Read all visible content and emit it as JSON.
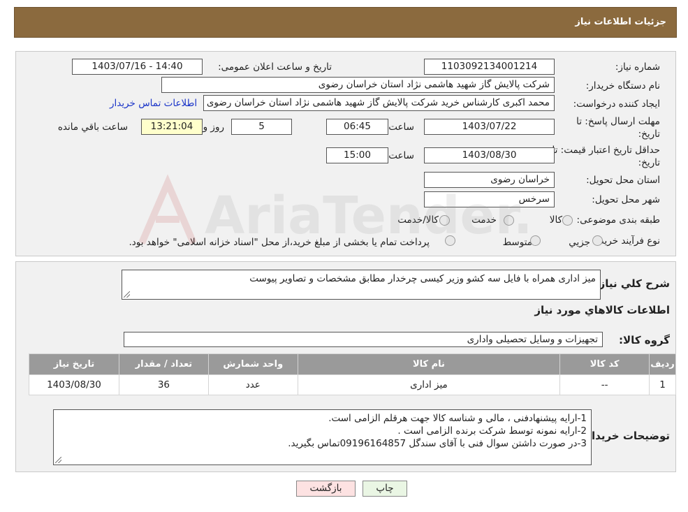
{
  "header": {
    "title": "جزئیات اطلاعات نیاز"
  },
  "form": {
    "need_number_label": "شماره نیاز:",
    "need_number": "1103092134001214",
    "announce_label": "تاریخ و ساعت اعلان عمومی:",
    "announce_value": "1403/07/16 - 14:40",
    "buyer_org_label": "نام دستگاه خریدار:",
    "buyer_org": "شرکت پالایش گاز شهید هاشمی نژاد   استان خراسان رضوی",
    "creator_label": "ایجاد کننده درخواست:",
    "creator": "محمد اکبری کارشناس خرید شرکت پالایش گاز شهید هاشمی نژاد   استان خراسان رضوی",
    "contact_link": "اطلاعات تماس خریدار",
    "deadline_label": "مهلت ارسال پاسخ: تا تاریخ:",
    "deadline_date": "1403/07/22",
    "time_label": "ساعت",
    "deadline_time": "06:45",
    "days_value": "5",
    "days_label": "روز و",
    "remaining_time": "13:21:04",
    "remaining_label": "ساعت باقي مانده",
    "validity_label": "حداقل تاریخ اعتبار قیمت: تا تاریخ:",
    "validity_date": "1403/08/30",
    "validity_time": "15:00",
    "province_label": "استان محل تحویل:",
    "province": "خراسان رضوی",
    "city_label": "شهر محل تحویل:",
    "city": "سرخس",
    "category_label": "طبقه بندی موضوعی:",
    "category_options": [
      "کالا",
      "خدمت",
      "کالا/خدمت"
    ],
    "process_label": "نوع فرآیند خرید :",
    "process_options": [
      "جزيي",
      "متوسط"
    ],
    "process_note": "پرداخت تمام یا بخشی از مبلغ خرید،از محل \"اسناد خزانه اسلامی\" خواهد بود."
  },
  "details": {
    "summary_label": "شرح كلي نياز:",
    "summary": "میز اداری همراه با فایل سه کشو وزیر کیسی چرخدار مطابق مشخصات و تصاویر پیوست",
    "goods_title": "اطلاعات کالاهاي مورد نياز",
    "group_label": "گروه کالا:",
    "group": "تجهیزات و وسایل تحصیلی واداری",
    "table": {
      "headers": [
        "ردیف",
        "کد کالا",
        "نام کالا",
        "واحد شمارش",
        "تعداد / مقدار",
        "تاریخ نیاز"
      ],
      "rows": [
        [
          "1",
          "--",
          "میز اداری",
          "عدد",
          "36",
          "1403/08/30"
        ]
      ]
    },
    "notes_label": "توضیحات خریدار:",
    "notes": [
      "1-ارایه پیشنهادفنی ، مالی و شناسه کالا جهت هرقلم الزامی است.",
      "2-ارایه نمونه توسط شرکت برنده الزامی است .",
      "3-در صورت داشتن سوال فنی با آقای سندگل 09196164857تماس بگیرید."
    ]
  },
  "buttons": {
    "print": "چاپ",
    "back": "بازگشت"
  },
  "watermark": {
    "text": "AriaTender.neT"
  },
  "colors": {
    "header": "#8b6a3e",
    "link": "#1a34c8",
    "back_button": "#fde2e2",
    "print_button": "#eaf6e4"
  }
}
